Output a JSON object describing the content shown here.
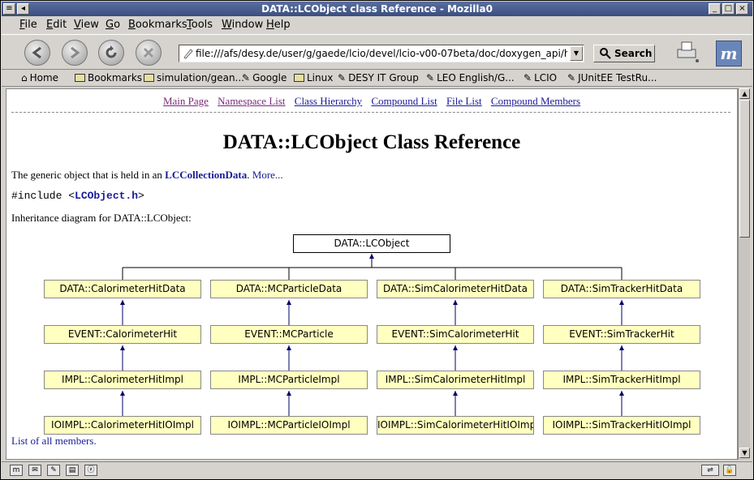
{
  "window": {
    "title": "DATA::LCObject class Reference - Mozilla0"
  },
  "menu": [
    {
      "label": "File",
      "accel": "F",
      "rest": "ile"
    },
    {
      "label": "Edit",
      "accel": "E",
      "rest": "dit"
    },
    {
      "label": "View",
      "accel": "V",
      "rest": "iew"
    },
    {
      "label": "Go",
      "accel": "G",
      "rest": "o"
    },
    {
      "label": "Bookmarks",
      "accel": "B",
      "rest": "ookmarks"
    },
    {
      "label": "Tools",
      "accel": "T",
      "rest": "ools"
    },
    {
      "label": "Window",
      "accel": "W",
      "rest": "indow"
    },
    {
      "label": "Help",
      "accel": "H",
      "rest": "elp"
    }
  ],
  "toolbar": {
    "url": "file:///afs/desy.de/user/g/gaede/lcio/devel/lcio-v00-07beta/doc/doxygen_api/html/class",
    "search_label": "Search"
  },
  "bookmarks": [
    {
      "label": "Home",
      "icon": "home-icon"
    },
    {
      "label": "Bookmarks",
      "icon": "folder-icon"
    },
    {
      "label": "simulation/gean...",
      "icon": "folder-icon"
    },
    {
      "label": "Google",
      "icon": "link-icon"
    },
    {
      "label": "Linux",
      "icon": "folder-icon"
    },
    {
      "label": "DESY IT Group",
      "icon": "link-icon"
    },
    {
      "label": "LEO English/G...",
      "icon": "link-icon"
    },
    {
      "label": "LCIO",
      "icon": "link-icon"
    },
    {
      "label": "JUnitEE TestRu...",
      "icon": "link-icon"
    }
  ],
  "page": {
    "nav": [
      "Main Page",
      "Namespace List",
      "Class Hierarchy",
      "Compound List",
      "File List",
      "Compound Members"
    ],
    "title": "DATA::LCObject Class Reference",
    "brief_prefix": "The generic object that is held in an ",
    "brief_link": "LCCollectionData",
    "brief_period": ". ",
    "more": "More...",
    "include_prefix": "#include <",
    "include_file": "LCObject.h",
    "include_suffix": ">",
    "inheritance_label": "Inheritance diagram for DATA::LCObject:",
    "all_members": "List of all members."
  },
  "diagram": {
    "root": "DATA::LCObject",
    "columns": [
      [
        "DATA::CalorimeterHitData",
        "EVENT::CalorimeterHit",
        "IMPL::CalorimeterHitImpl",
        "IOIMPL::CalorimeterHitIOImpl"
      ],
      [
        "DATA::MCParticleData",
        "EVENT::MCParticle",
        "IMPL::MCParticleImpl",
        "IOIMPL::MCParticleIOImpl"
      ],
      [
        "DATA::SimCalorimeterHitData",
        "EVENT::SimCalorimeterHit",
        "IMPL::SimCalorimeterHitImpl",
        "IOIMPL::SimCalorimeterHitIOImpl"
      ],
      [
        "DATA::SimTrackerHitData",
        "EVENT::SimTrackerHit",
        "IMPL::SimTrackerHitImpl",
        "IOIMPL::SimTrackerHitIOImpl"
      ]
    ]
  },
  "colors": {
    "node_fill": "#ffffc0",
    "link": "#1a1a99",
    "visited_link": "#7a2a7a",
    "titlebar": "#3a4e80"
  }
}
